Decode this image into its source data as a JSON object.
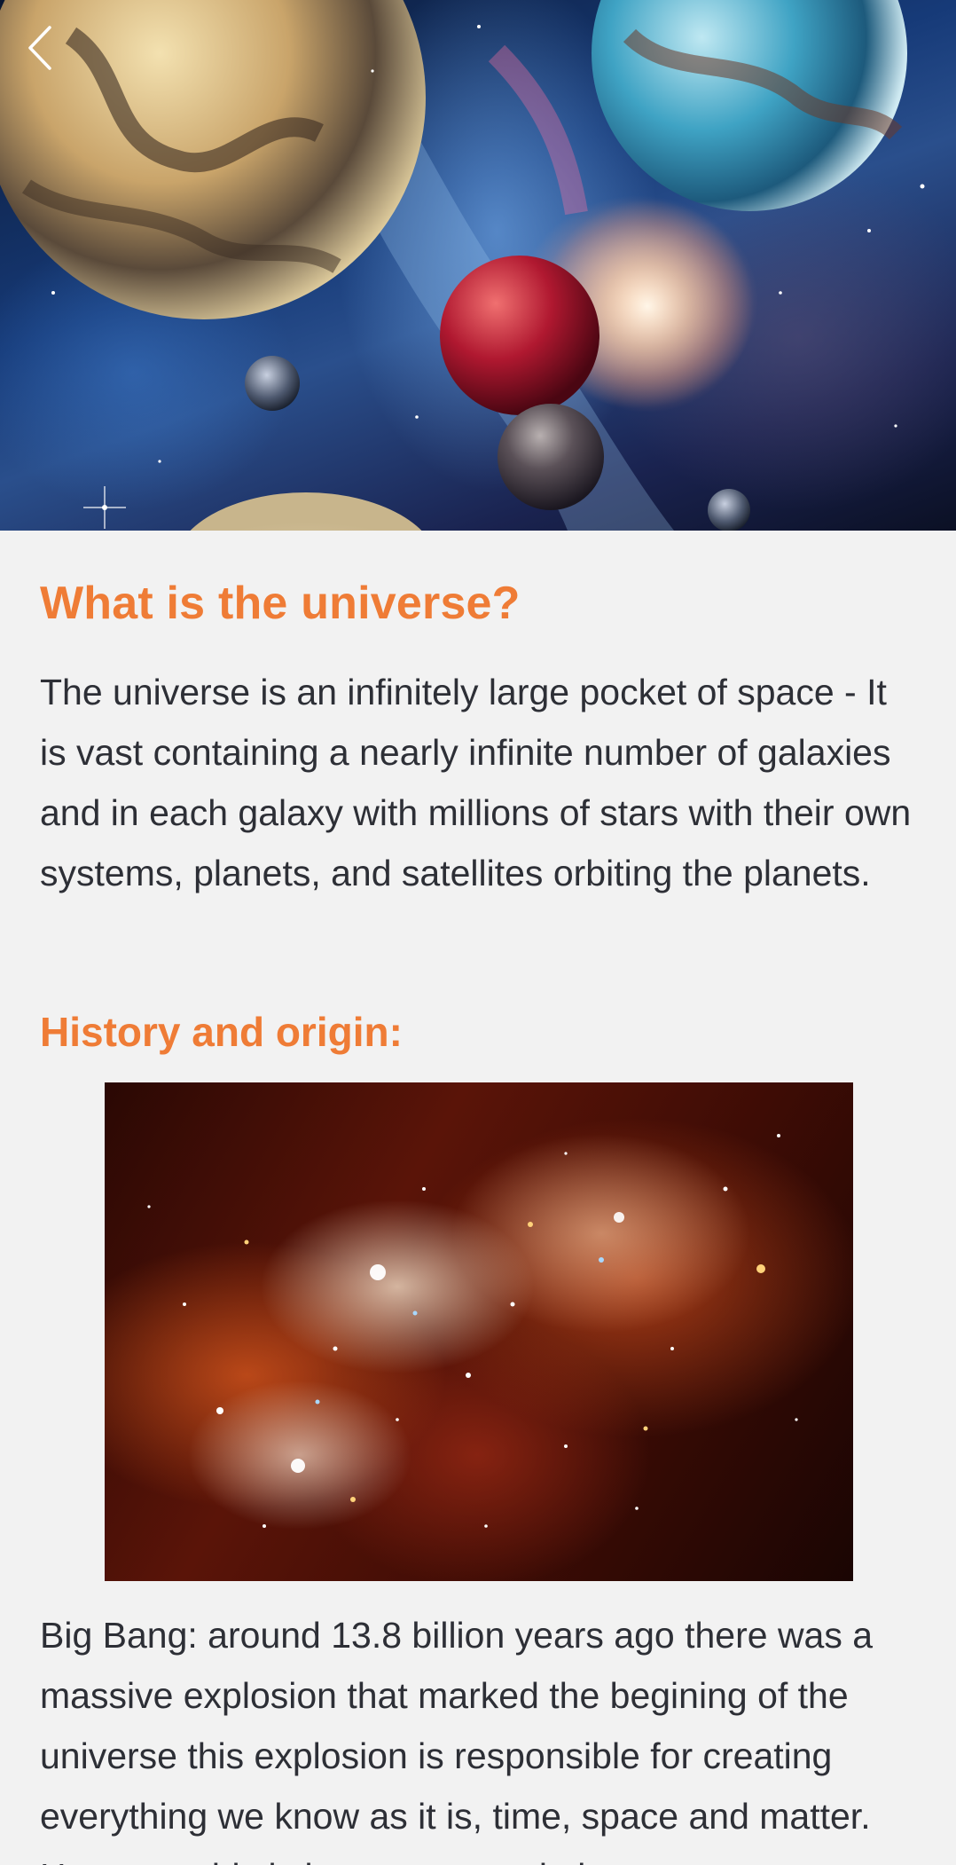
{
  "nav": {
    "back_icon": "chevron-left-icon"
  },
  "article": {
    "title": "What is the universe?",
    "intro": "The universe is an infinitely large pocket of space - It is vast containing a nearly infinite number of galaxies and in each galaxy with millions of stars with their own systems, planets, and satellites orbiting the planets.",
    "section_title": "History and origin:",
    "section_body": "Big Bang: around 13.8 billion years ago there was a massive explosion that marked the begining of the universe this explosion is responsible for creating everything we know as it is, time, space and matter. However, this is just one speculation"
  },
  "colors": {
    "heading": "#ef7c36",
    "body_text": "#2d2f36",
    "background": "#f2f2f2"
  }
}
